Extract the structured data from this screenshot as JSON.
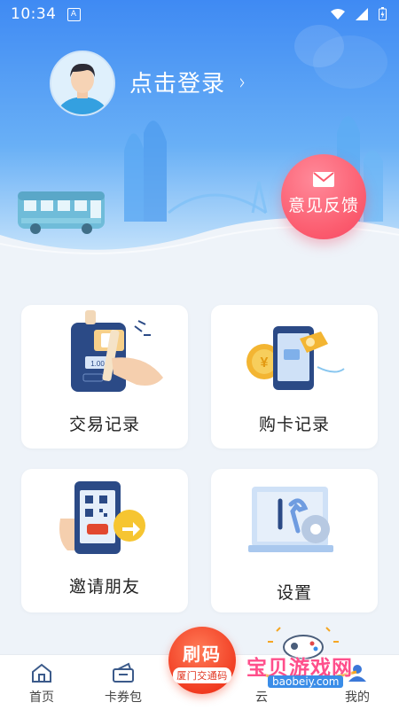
{
  "status_bar": {
    "time": "10:34",
    "notif_glyph": "A"
  },
  "header": {
    "login_text": "点击登录",
    "login_chevron": "›",
    "feedback_label": "意见反馈"
  },
  "cards": [
    {
      "label": "交易记录",
      "icon": "transaction-record-icon"
    },
    {
      "label": "购卡记录",
      "icon": "card-purchase-record-icon"
    },
    {
      "label": "邀请朋友",
      "icon": "invite-friends-icon"
    },
    {
      "label": "设置",
      "icon": "settings-icon"
    }
  ],
  "card_illustration_text": {
    "amount": "1.00"
  },
  "tabbar": {
    "tabs": [
      {
        "label": "首页",
        "icon": "home-icon"
      },
      {
        "label": "卡券包",
        "icon": "coupon-icon"
      },
      {
        "label": "云",
        "icon": "cloud-icon"
      },
      {
        "label": "我的",
        "icon": "profile-icon"
      }
    ],
    "scan_button": {
      "label": "刷码",
      "sublabel": "厦门交通码"
    }
  },
  "watermark": {
    "text": "宝贝游戏网",
    "url": "baobeiy.com"
  },
  "colors": {
    "header_top": "#3f8af3",
    "feedback": "#fb5a6d",
    "scan_button": "#f0391f",
    "background": "#eef3f9"
  }
}
